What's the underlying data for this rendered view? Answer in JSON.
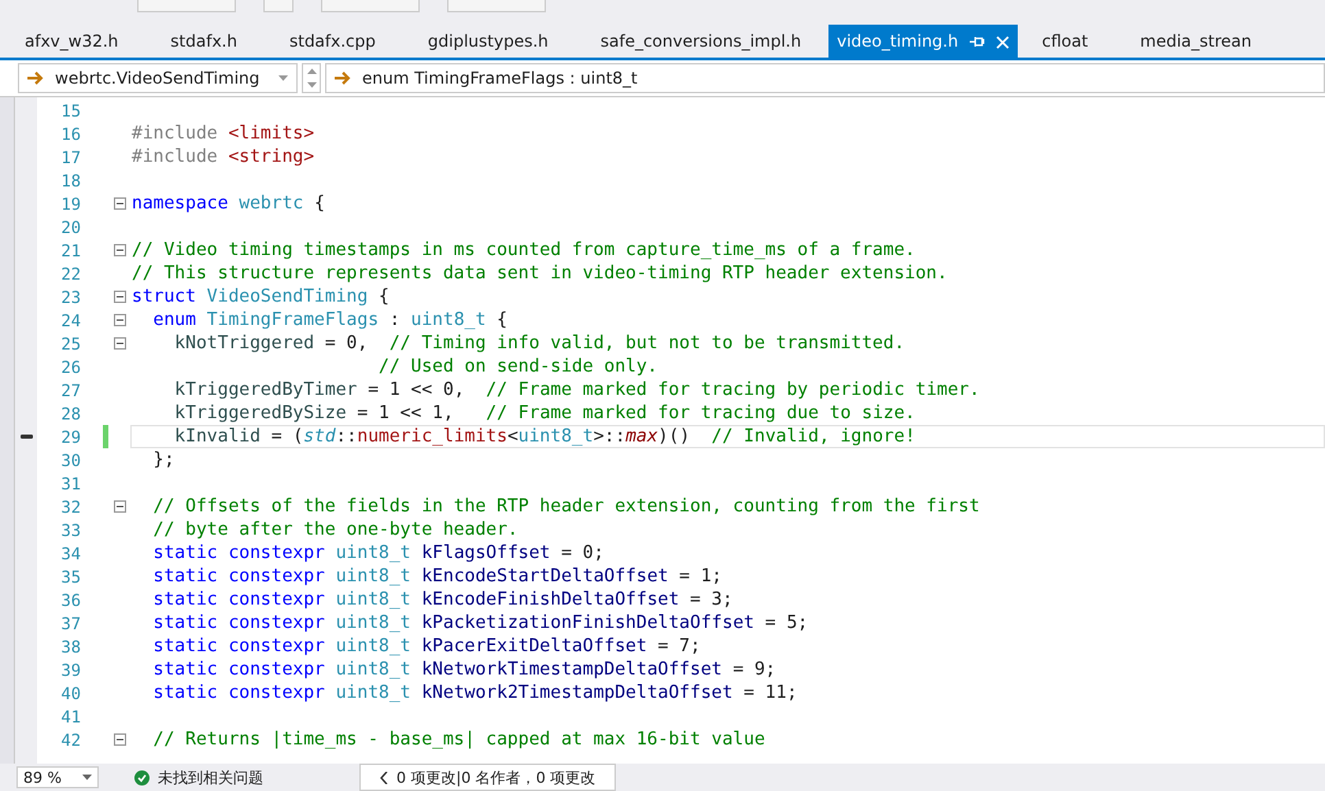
{
  "tabs": [
    {
      "label": "afxv_w32.h",
      "selected": false
    },
    {
      "label": "stdafx.h",
      "selected": false
    },
    {
      "label": "stdafx.cpp",
      "selected": false
    },
    {
      "label": "gdiplustypes.h",
      "selected": false
    },
    {
      "label": "safe_conversions_impl.h",
      "selected": false
    },
    {
      "label": "video_timing.h",
      "selected": true
    },
    {
      "label": "cfloat",
      "selected": false
    },
    {
      "label": "media_strean",
      "selected": false
    }
  ],
  "navigation": {
    "scope": "webrtc.VideoSendTiming",
    "member": "enum TimingFrameFlags : uint8_t"
  },
  "code_lines": [
    {
      "number": "15",
      "fold": false,
      "changed": false
    },
    {
      "number": "16",
      "fold": false,
      "changed": false,
      "tokens": [
        {
          "kind": "pre",
          "text": "#include"
        },
        {
          "kind": "str",
          "text": " <limits>"
        }
      ]
    },
    {
      "number": "17",
      "fold": false,
      "changed": false,
      "tokens": [
        {
          "kind": "pre",
          "text": "#include"
        },
        {
          "kind": "str",
          "text": " <string>"
        }
      ]
    },
    {
      "number": "18",
      "fold": false,
      "changed": false
    },
    {
      "number": "19",
      "fold": true,
      "changed": false,
      "tokens": [
        {
          "kind": "kw",
          "text": "namespace"
        },
        {
          "kind": "type",
          "text": " webrtc"
        },
        {
          "kind": "plain",
          "text": " {"
        }
      ]
    },
    {
      "number": "20",
      "fold": false,
      "changed": false
    },
    {
      "number": "21",
      "fold": true,
      "changed": false,
      "tokens": [
        {
          "kind": "cmt",
          "text": "// Video timing timestamps in ms counted from capture_time_ms of a frame."
        }
      ]
    },
    {
      "number": "22",
      "fold": false,
      "changed": false,
      "tokens": [
        {
          "kind": "cmt",
          "text": "// This structure represents data sent in video-timing RTP header extension."
        }
      ]
    },
    {
      "number": "23",
      "fold": true,
      "changed": false,
      "tokens": [
        {
          "kind": "kw",
          "text": "struct"
        },
        {
          "kind": "type",
          "text": " VideoSendTiming"
        },
        {
          "kind": "plain",
          "text": " {"
        }
      ]
    },
    {
      "number": "24",
      "fold": true,
      "changed": false,
      "tokens": [
        {
          "kind": "kw",
          "text": "  enum"
        },
        {
          "kind": "type",
          "text": " TimingFrameFlags"
        },
        {
          "kind": "plain",
          "text": " :"
        },
        {
          "kind": "type",
          "text": " uint8_t"
        },
        {
          "kind": "plain",
          "text": " {"
        }
      ]
    },
    {
      "number": "25",
      "fold": true,
      "changed": false,
      "tokens": [
        {
          "kind": "enum",
          "text": "    kNotTriggered"
        },
        {
          "kind": "plain",
          "text": " = 0,"
        },
        {
          "kind": "cmt",
          "text": "  // Timing info valid, but not to be transmitted."
        }
      ]
    },
    {
      "number": "26",
      "fold": false,
      "changed": false,
      "tokens": [
        {
          "kind": "cmt",
          "text": "                       // Used on send-side only."
        }
      ]
    },
    {
      "number": "27",
      "fold": false,
      "changed": false,
      "tokens": [
        {
          "kind": "enum",
          "text": "    kTriggeredByTimer"
        },
        {
          "kind": "plain",
          "text": " = 1 << 0,"
        },
        {
          "kind": "cmt",
          "text": "  // Frame marked for tracing by periodic timer."
        }
      ]
    },
    {
      "number": "28",
      "fold": false,
      "changed": false,
      "tokens": [
        {
          "kind": "enum",
          "text": "    kTriggeredBySize"
        },
        {
          "kind": "plain",
          "text": " = 1 << 1,"
        },
        {
          "kind": "cmt",
          "text": "   // Frame marked for tracing due to size."
        }
      ]
    },
    {
      "number": "29",
      "fold": false,
      "changed": true,
      "tokens": [
        {
          "kind": "enum",
          "text": "    kInvalid"
        },
        {
          "kind": "plain",
          "text": " = ("
        },
        {
          "kind": "itype",
          "text": "std"
        },
        {
          "kind": "plain",
          "text": "::"
        },
        {
          "kind": "fn",
          "text": "numeric_limits"
        },
        {
          "kind": "plain",
          "text": "<"
        },
        {
          "kind": "type",
          "text": "uint8_t"
        },
        {
          "kind": "plain",
          "text": ">::"
        },
        {
          "kind": "ifn",
          "text": "max"
        },
        {
          "kind": "plain",
          "text": ")()"
        },
        {
          "kind": "cmt",
          "text": "  // Invalid, ignore!"
        }
      ]
    },
    {
      "number": "30",
      "fold": false,
      "changed": false,
      "tokens": [
        {
          "kind": "plain",
          "text": "  };"
        }
      ]
    },
    {
      "number": "31",
      "fold": false,
      "changed": false
    },
    {
      "number": "32",
      "fold": true,
      "changed": false,
      "tokens": [
        {
          "kind": "cmt",
          "text": "  // Offsets of the fields in the RTP header extension, counting from the first"
        }
      ]
    },
    {
      "number": "33",
      "fold": false,
      "changed": false,
      "tokens": [
        {
          "kind": "cmt",
          "text": "  // byte after the one-byte header."
        }
      ]
    },
    {
      "number": "34",
      "fold": false,
      "changed": false,
      "tokens": [
        {
          "kind": "kw",
          "text": "  static constexpr"
        },
        {
          "kind": "type",
          "text": " uint8_t"
        },
        {
          "kind": "field",
          "text": " kFlagsOffset"
        },
        {
          "kind": "plain",
          "text": " = 0;"
        }
      ]
    },
    {
      "number": "35",
      "fold": false,
      "changed": false,
      "tokens": [
        {
          "kind": "kw",
          "text": "  static constexpr"
        },
        {
          "kind": "type",
          "text": " uint8_t"
        },
        {
          "kind": "field",
          "text": " kEncodeStartDeltaOffset"
        },
        {
          "kind": "plain",
          "text": " = 1;"
        }
      ]
    },
    {
      "number": "36",
      "fold": false,
      "changed": false,
      "tokens": [
        {
          "kind": "kw",
          "text": "  static constexpr"
        },
        {
          "kind": "type",
          "text": " uint8_t"
        },
        {
          "kind": "field",
          "text": " kEncodeFinishDeltaOffset"
        },
        {
          "kind": "plain",
          "text": " = 3;"
        }
      ]
    },
    {
      "number": "37",
      "fold": false,
      "changed": false,
      "tokens": [
        {
          "kind": "kw",
          "text": "  static constexpr"
        },
        {
          "kind": "type",
          "text": " uint8_t"
        },
        {
          "kind": "field",
          "text": " kPacketizationFinishDeltaOffset"
        },
        {
          "kind": "plain",
          "text": " = 5;"
        }
      ]
    },
    {
      "number": "38",
      "fold": false,
      "changed": false,
      "tokens": [
        {
          "kind": "kw",
          "text": "  static constexpr"
        },
        {
          "kind": "type",
          "text": " uint8_t"
        },
        {
          "kind": "field",
          "text": " kPacerExitDeltaOffset"
        },
        {
          "kind": "plain",
          "text": " = 7;"
        }
      ]
    },
    {
      "number": "39",
      "fold": false,
      "changed": false,
      "tokens": [
        {
          "kind": "kw",
          "text": "  static constexpr"
        },
        {
          "kind": "type",
          "text": " uint8_t"
        },
        {
          "kind": "field",
          "text": " kNetworkTimestampDeltaOffset"
        },
        {
          "kind": "plain",
          "text": " = 9;"
        }
      ]
    },
    {
      "number": "40",
      "fold": false,
      "changed": false,
      "tokens": [
        {
          "kind": "kw",
          "text": "  static constexpr"
        },
        {
          "kind": "type",
          "text": " uint8_t"
        },
        {
          "kind": "field",
          "text": " kNetwork2TimestampDeltaOffset"
        },
        {
          "kind": "plain",
          "text": " = 11;"
        }
      ]
    },
    {
      "number": "41",
      "fold": false,
      "changed": false
    },
    {
      "number": "42",
      "fold": true,
      "changed": false,
      "tokens": [
        {
          "kind": "cmt",
          "text": "  // Returns |time_ms - base_ms| capped at max 16-bit value"
        }
      ]
    }
  ],
  "status_bar": {
    "zoom": "89 %",
    "issues": "未找到相关问题",
    "changes": "0 项更改|0 名作者，0 项更改"
  }
}
